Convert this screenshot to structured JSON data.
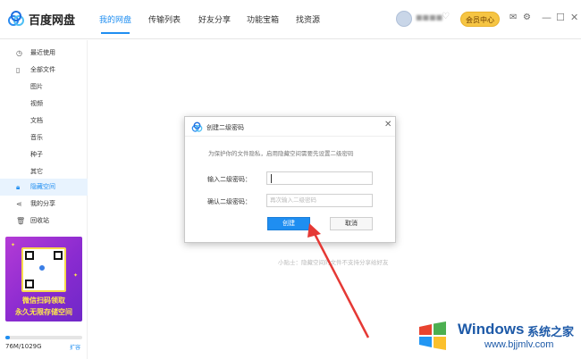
{
  "app": {
    "name": "百度网盘"
  },
  "tabs": [
    {
      "label": "我的网盘",
      "active": true
    },
    {
      "label": "传输列表",
      "active": false
    },
    {
      "label": "好友分享",
      "active": false
    },
    {
      "label": "功能宝箱",
      "active": false
    },
    {
      "label": "找资源",
      "active": false
    }
  ],
  "header": {
    "vip_label": "会员中心"
  },
  "sidebar": {
    "items": [
      {
        "label": "最近使用",
        "icon": "clock-icon"
      },
      {
        "label": "全部文件",
        "icon": "file-icon"
      },
      {
        "label": "图片"
      },
      {
        "label": "视频"
      },
      {
        "label": "文档"
      },
      {
        "label": "音乐"
      },
      {
        "label": "种子"
      },
      {
        "label": "其它"
      },
      {
        "label": "隐藏空间",
        "icon": "lock-icon",
        "active": true
      },
      {
        "label": "我的分享",
        "icon": "share-icon"
      },
      {
        "label": "回收站",
        "icon": "trash-icon"
      }
    ],
    "promo": {
      "line1": "微信扫码领取",
      "line2": "永久无限存储空间"
    },
    "storage": {
      "text": "76M/1029G",
      "expand_label": "扩容",
      "used_fraction": 0.06
    }
  },
  "main": {
    "hint": "小贴士：隐藏空间的文件不支持分享给好友"
  },
  "dialog": {
    "title": "创建二级密码",
    "description": "为保护你的文件隐私，启用隐藏空间需要先设置二级密码",
    "fields": [
      {
        "label": "输入二级密码：",
        "value": "",
        "placeholder": ""
      },
      {
        "label": "确认二级密码：",
        "value": "",
        "placeholder": "再次输入二级密码"
      }
    ],
    "create_label": "创建",
    "cancel_label": "取消"
  },
  "watermark": {
    "title": "Windows",
    "title2": "系统之家",
    "url": "www.bjjmlv.com"
  },
  "colors": {
    "accent": "#1f8ef1",
    "vip": "#f6c543",
    "arrow": "#e53935",
    "promo": "#8a2bd0"
  }
}
